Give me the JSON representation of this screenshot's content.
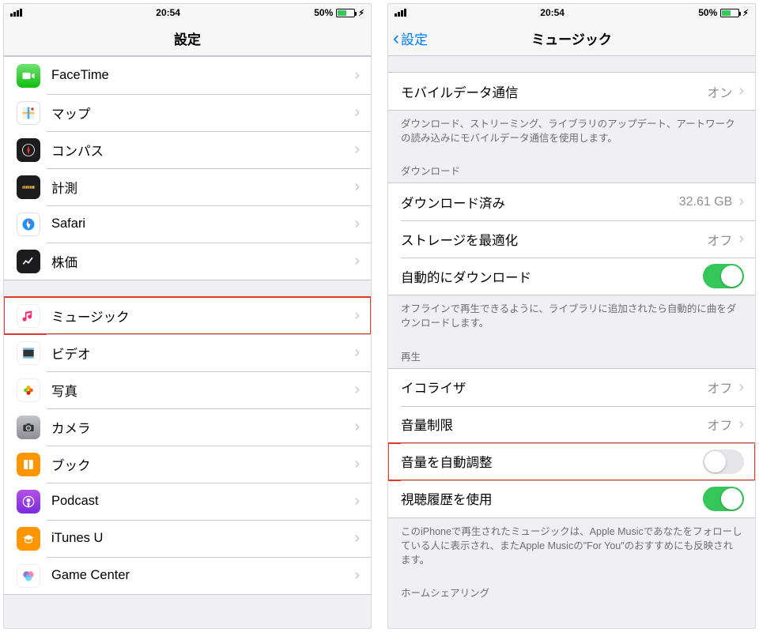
{
  "status": {
    "time": "20:54",
    "battery_pct": "50%"
  },
  "left": {
    "title": "設定",
    "groups": [
      {
        "items": [
          {
            "id": "facetime",
            "label": "FaceTime"
          },
          {
            "id": "maps",
            "label": "マップ"
          },
          {
            "id": "compass",
            "label": "コンパス"
          },
          {
            "id": "measure",
            "label": "計測"
          },
          {
            "id": "safari",
            "label": "Safari"
          },
          {
            "id": "stocks",
            "label": "株価"
          }
        ]
      },
      {
        "items": [
          {
            "id": "music",
            "label": "ミュージック",
            "highlighted": true
          },
          {
            "id": "video",
            "label": "ビデオ"
          },
          {
            "id": "photos",
            "label": "写真"
          },
          {
            "id": "camera",
            "label": "カメラ"
          },
          {
            "id": "books",
            "label": "ブック"
          },
          {
            "id": "podcast",
            "label": "Podcast"
          },
          {
            "id": "itunesu",
            "label": "iTunes U"
          },
          {
            "id": "gc",
            "label": "Game Center"
          }
        ]
      }
    ]
  },
  "right": {
    "back_label": "設定",
    "title": "ミュージック",
    "sections": [
      {
        "items": [
          {
            "label": "モバイルデータ通信",
            "value": "オン",
            "type": "link"
          }
        ],
        "footer": "ダウンロード、ストリーミング、ライブラリのアップデート、アートワークの読み込みにモバイルデータ通信を使用します。"
      },
      {
        "header": "ダウンロード",
        "items": [
          {
            "label": "ダウンロード済み",
            "value": "32.61 GB",
            "type": "link"
          },
          {
            "label": "ストレージを最適化",
            "value": "オフ",
            "type": "link"
          },
          {
            "label": "自動的にダウンロード",
            "type": "toggle",
            "on": true
          }
        ],
        "footer": "オフラインで再生できるように、ライブラリに追加されたら自動的に曲をダウンロードします。"
      },
      {
        "header": "再生",
        "items": [
          {
            "label": "イコライザ",
            "value": "オフ",
            "type": "link"
          },
          {
            "label": "音量制限",
            "value": "オフ",
            "type": "link"
          },
          {
            "label": "音量を自動調整",
            "type": "toggle",
            "on": false,
            "highlighted": true
          },
          {
            "label": "視聴履歴を使用",
            "type": "toggle",
            "on": true
          }
        ],
        "footer": "このiPhoneで再生されたミュージックは、Apple Musicであなたをフォローしている人に表示され、またApple Musicの\"For You\"のおすすめにも反映されます。"
      },
      {
        "header": "ホームシェアリング",
        "items": []
      }
    ]
  }
}
